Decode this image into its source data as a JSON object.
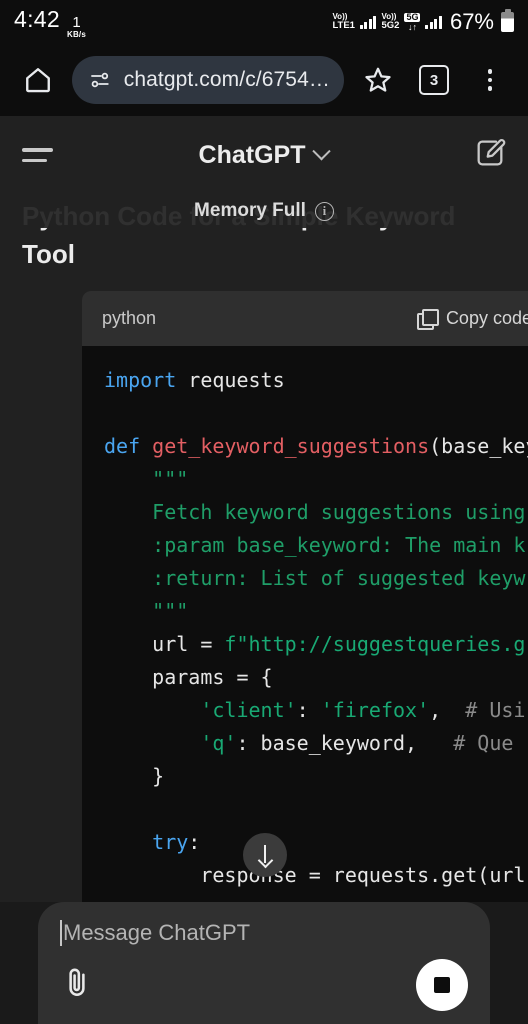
{
  "status_bar": {
    "time": "4:42",
    "net_speed_value": "1",
    "net_speed_unit": "KB/s",
    "sim1_volte_top": "Vo))",
    "sim1_volte_bottom": "LTE1",
    "sim2_volte_top": "Vo))",
    "sim2_volte_bottom": "5G2",
    "network_tag": "5G",
    "data_arrows": "↓↑",
    "battery_percent": "67%"
  },
  "browser": {
    "home_icon": "home-icon",
    "site_settings_icon": "site-settings-icon",
    "url": "chatgpt.com/c/6754…",
    "bookmark_icon": "star-icon",
    "tab_count": "3",
    "menu_icon": "kebab-menu-icon"
  },
  "app_header": {
    "menu_icon": "hamburger-icon",
    "title": "ChatGPT",
    "dropdown_icon": "chevron-down-icon",
    "compose_icon": "compose-icon"
  },
  "memory_banner": {
    "label": "Memory Full",
    "info_icon": "info-icon",
    "info_glyph": "i"
  },
  "message": {
    "title": "Python Code for a Simple Keyword Tool"
  },
  "code_block": {
    "language": "python",
    "copy_label": "Copy code",
    "copy_icon": "copy-icon",
    "lines": [
      {
        "indent": 0,
        "tokens": [
          {
            "t": "import ",
            "c": "kw"
          },
          {
            "t": "requests",
            "c": "pln"
          }
        ]
      },
      {
        "indent": 0,
        "tokens": []
      },
      {
        "indent": 0,
        "tokens": [
          {
            "t": "def ",
            "c": "kw"
          },
          {
            "t": "get_keyword_suggestions",
            "c": "fn"
          },
          {
            "t": "(base_key",
            "c": "pln"
          }
        ]
      },
      {
        "indent": 1,
        "tokens": [
          {
            "t": "\"\"\"",
            "c": "doc"
          }
        ]
      },
      {
        "indent": 1,
        "tokens": [
          {
            "t": "Fetch keyword suggestions using",
            "c": "doc"
          }
        ]
      },
      {
        "indent": 1,
        "tokens": [
          {
            "t": ":param base_keyword: The main k",
            "c": "doc"
          }
        ]
      },
      {
        "indent": 1,
        "tokens": [
          {
            "t": ":return: List of suggested keyw",
            "c": "doc"
          }
        ]
      },
      {
        "indent": 1,
        "tokens": [
          {
            "t": "\"\"\"",
            "c": "doc"
          }
        ]
      },
      {
        "indent": 1,
        "tokens": [
          {
            "t": "url = ",
            "c": "pln"
          },
          {
            "t": "f\"http://suggestqueries.g",
            "c": "str"
          }
        ]
      },
      {
        "indent": 1,
        "tokens": [
          {
            "t": "params = {",
            "c": "pln"
          }
        ]
      },
      {
        "indent": 2,
        "tokens": [
          {
            "t": "'client'",
            "c": "str"
          },
          {
            "t": ": ",
            "c": "pln"
          },
          {
            "t": "'firefox'",
            "c": "str"
          },
          {
            "t": ",  ",
            "c": "pln"
          },
          {
            "t": "# Usi",
            "c": "cmt"
          }
        ]
      },
      {
        "indent": 2,
        "tokens": [
          {
            "t": "'q'",
            "c": "str"
          },
          {
            "t": ": base_keyword,   ",
            "c": "pln"
          },
          {
            "t": "# Que",
            "c": "cmt"
          }
        ]
      },
      {
        "indent": 1,
        "tokens": [
          {
            "t": "}",
            "c": "pln"
          }
        ]
      },
      {
        "indent": 0,
        "tokens": []
      },
      {
        "indent": 1,
        "tokens": [
          {
            "t": "try",
            "c": "kw"
          },
          {
            "t": ":",
            "c": "pln"
          }
        ]
      },
      {
        "indent": 2,
        "tokens": [
          {
            "t": "response = requests.get(url",
            "c": "pln"
          }
        ]
      }
    ]
  },
  "scroll_button": {
    "icon": "arrow-down-icon"
  },
  "composer": {
    "placeholder": "Message ChatGPT",
    "attach_icon": "paperclip-icon",
    "attach_glyph": "ǁ",
    "stop_icon": "stop-icon"
  },
  "colors": {
    "app_background": "#212121",
    "chrome_background": "#0d0d0d",
    "code_background": "#0d0d0d",
    "code_header": "#2f2f2f",
    "composer_background": "#303030",
    "keyword": "#4aa5f0",
    "function": "#e35f63",
    "string": "#19a974",
    "comment": "#8a8a8a"
  }
}
